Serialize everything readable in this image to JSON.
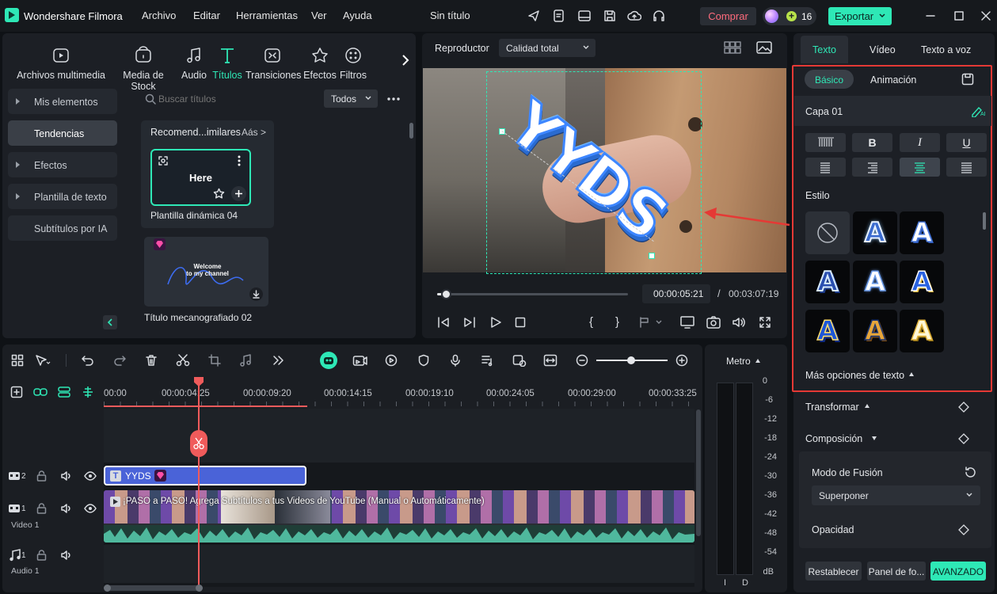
{
  "app": {
    "name": "Wondershare Filmora",
    "project_title": "Sin título",
    "credits": "16"
  },
  "menu": [
    "Archivo",
    "Editar",
    "Herramientas",
    "Ver",
    "Ayuda"
  ],
  "buttons": {
    "buy": "Comprar",
    "export": "Exportar"
  },
  "media_tabs": [
    {
      "label": "Archivos multimedia",
      "icon": "media-icon"
    },
    {
      "label": "Media de Stock",
      "icon": "stock-icon"
    },
    {
      "label": "Audio",
      "icon": "music-icon"
    },
    {
      "label": "Títulos",
      "icon": "title-T-icon"
    },
    {
      "label": "Transiciones",
      "icon": "transitions-icon"
    },
    {
      "label": "Efectos",
      "icon": "effects-icon"
    },
    {
      "label": "Filtros",
      "icon": "filters-icon"
    }
  ],
  "sidebar": [
    {
      "label": "Mis elementos",
      "arrow": true
    },
    {
      "label": "Tendencias",
      "arrow": false,
      "active": true
    },
    {
      "label": "Efectos",
      "arrow": true
    },
    {
      "label": "Plantilla de texto",
      "arrow": true
    },
    {
      "label": "Subtítulos por IA",
      "arrow": false
    }
  ],
  "search": {
    "placeholder": "Buscar títulos",
    "filter": "Todos"
  },
  "titles_panel": {
    "section": "Recomend...imilares",
    "more": "Aás >",
    "card1_text": "Here",
    "card1_label": "Plantilla dinámica 04",
    "card2_text": "Welcome\nto my channel",
    "card2_label": "Título mecanografiado 02"
  },
  "player": {
    "label": "Reproductor",
    "quality": "Calidad total",
    "overlay_text": "YYDS",
    "current_time": "00:00:05:21",
    "separator": "/",
    "total_time": "00:03:07:19",
    "progress": 0.04
  },
  "right_panel": {
    "tabs": [
      "Texto",
      "Vídeo",
      "Texto a voz"
    ],
    "subtabs": [
      "Básico",
      "Animación"
    ],
    "layer": "Capa 01",
    "style_label": "Estilo",
    "more_options": "Más opciones de texto",
    "transform": "Transformar",
    "composition": "Composición",
    "blend_mode_label": "Modo de Fusión",
    "blend_mode_value": "Superponer",
    "opacity_label": "Opacidad",
    "reset_btn": "Restablecer",
    "panel_btn": "Panel de fo...",
    "advanced_btn": "AVANZADO",
    "format_buttons": [
      "B",
      "I",
      "U"
    ]
  },
  "timeline": {
    "ruler": [
      "00:00",
      "00:00:04:25",
      "00:00:09:20",
      "00:00:14:15",
      "00:00:19:10",
      "00:00:24:05",
      "00:00:29:00",
      "00:00:33:25"
    ],
    "title_clip": "YYDS",
    "video_clip": "¡PASO a PASO! Agrega Subtítulos a tus Videos de YouTube (Manual o Automáticamente)",
    "track2_num": "2",
    "track1_num": "1",
    "track1_label": "Video 1",
    "audio_num": "1",
    "audio_label": "Audio 1"
  },
  "meter": {
    "label": "Metro",
    "scale": [
      "0",
      "-6",
      "-12",
      "-18",
      "-24",
      "-30",
      "-36",
      "-42",
      "-48",
      "-54",
      "dB"
    ],
    "channels": [
      "I",
      "D"
    ]
  },
  "colors": {
    "accent": "#2ee8b6",
    "highlight_red": "#e53935",
    "playhead": "#f05b5b",
    "clip_blue": "#4a63d8"
  }
}
